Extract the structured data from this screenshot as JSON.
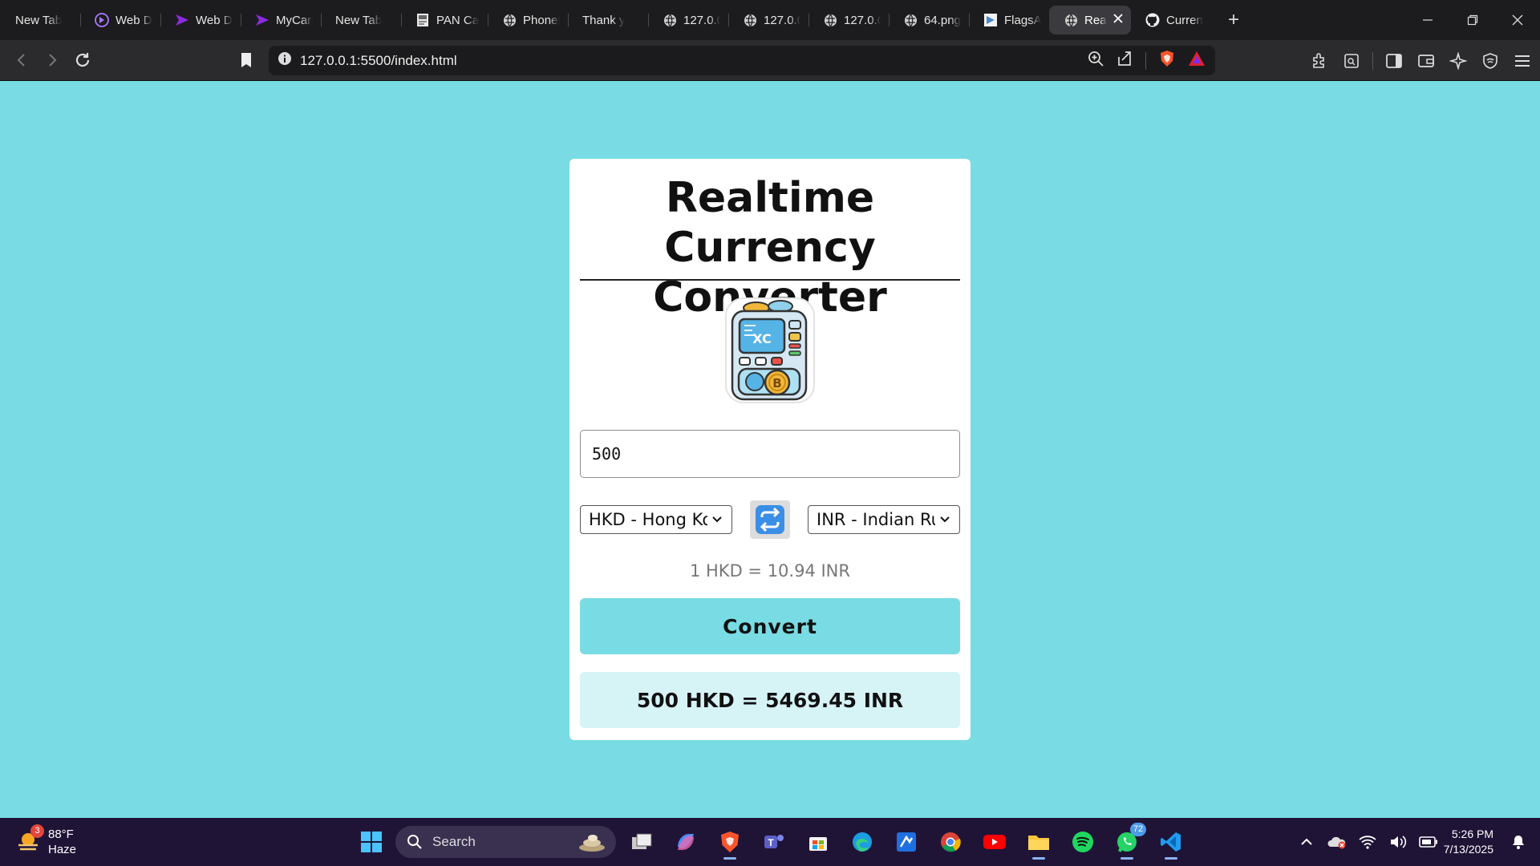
{
  "browser": {
    "tabs": [
      {
        "label": "New Tab",
        "icon": "none"
      },
      {
        "label": "Web De",
        "icon": "web-dev-icon"
      },
      {
        "label": "Web De",
        "icon": "chevron-brand-icon"
      },
      {
        "label": "MyCare",
        "icon": "chevron-brand-icon"
      },
      {
        "label": "New Tab",
        "icon": "none"
      },
      {
        "label": "PAN Ca",
        "icon": "document-icon"
      },
      {
        "label": "PhoneF",
        "icon": "globe-icon"
      },
      {
        "label": "Thank y",
        "icon": "none"
      },
      {
        "label": "127.0.0",
        "icon": "globe-icon"
      },
      {
        "label": "127.0.0",
        "icon": "globe-icon"
      },
      {
        "label": "127.0.0",
        "icon": "globe-icon"
      },
      {
        "label": "64.png",
        "icon": "globe-icon"
      },
      {
        "label": "FlagsAl",
        "icon": "flag-icon"
      },
      {
        "label": "Rea",
        "icon": "globe-icon",
        "active": true
      },
      {
        "label": "Curren",
        "icon": "github-icon"
      }
    ],
    "new_tab_label": "+",
    "url": "127.0.0.1:5500/index.html"
  },
  "app": {
    "title": "Realtime Currency Converter",
    "amount": "500",
    "from_currency": "HKD - Hong Kong Dollar",
    "to_currency": "INR - Indian Rupee",
    "exchange_rate_text": "1 HKD = 10.94 INR",
    "convert_label": "Convert",
    "result_text": "500 HKD = 5469.45 INR",
    "logo_icon": "currency-exchange-machine-icon"
  },
  "taskbar": {
    "weather_temp": "88°F",
    "weather_desc": "Haze",
    "weather_badge": "3",
    "search_label": "Search",
    "whatsapp_badge": "72",
    "time": "5:26 PM",
    "date": "7/13/2025"
  },
  "colors": {
    "page_background": "#79dbe3",
    "result_background": "#d6f3f6",
    "browser_dark": "#1c1c1e"
  }
}
